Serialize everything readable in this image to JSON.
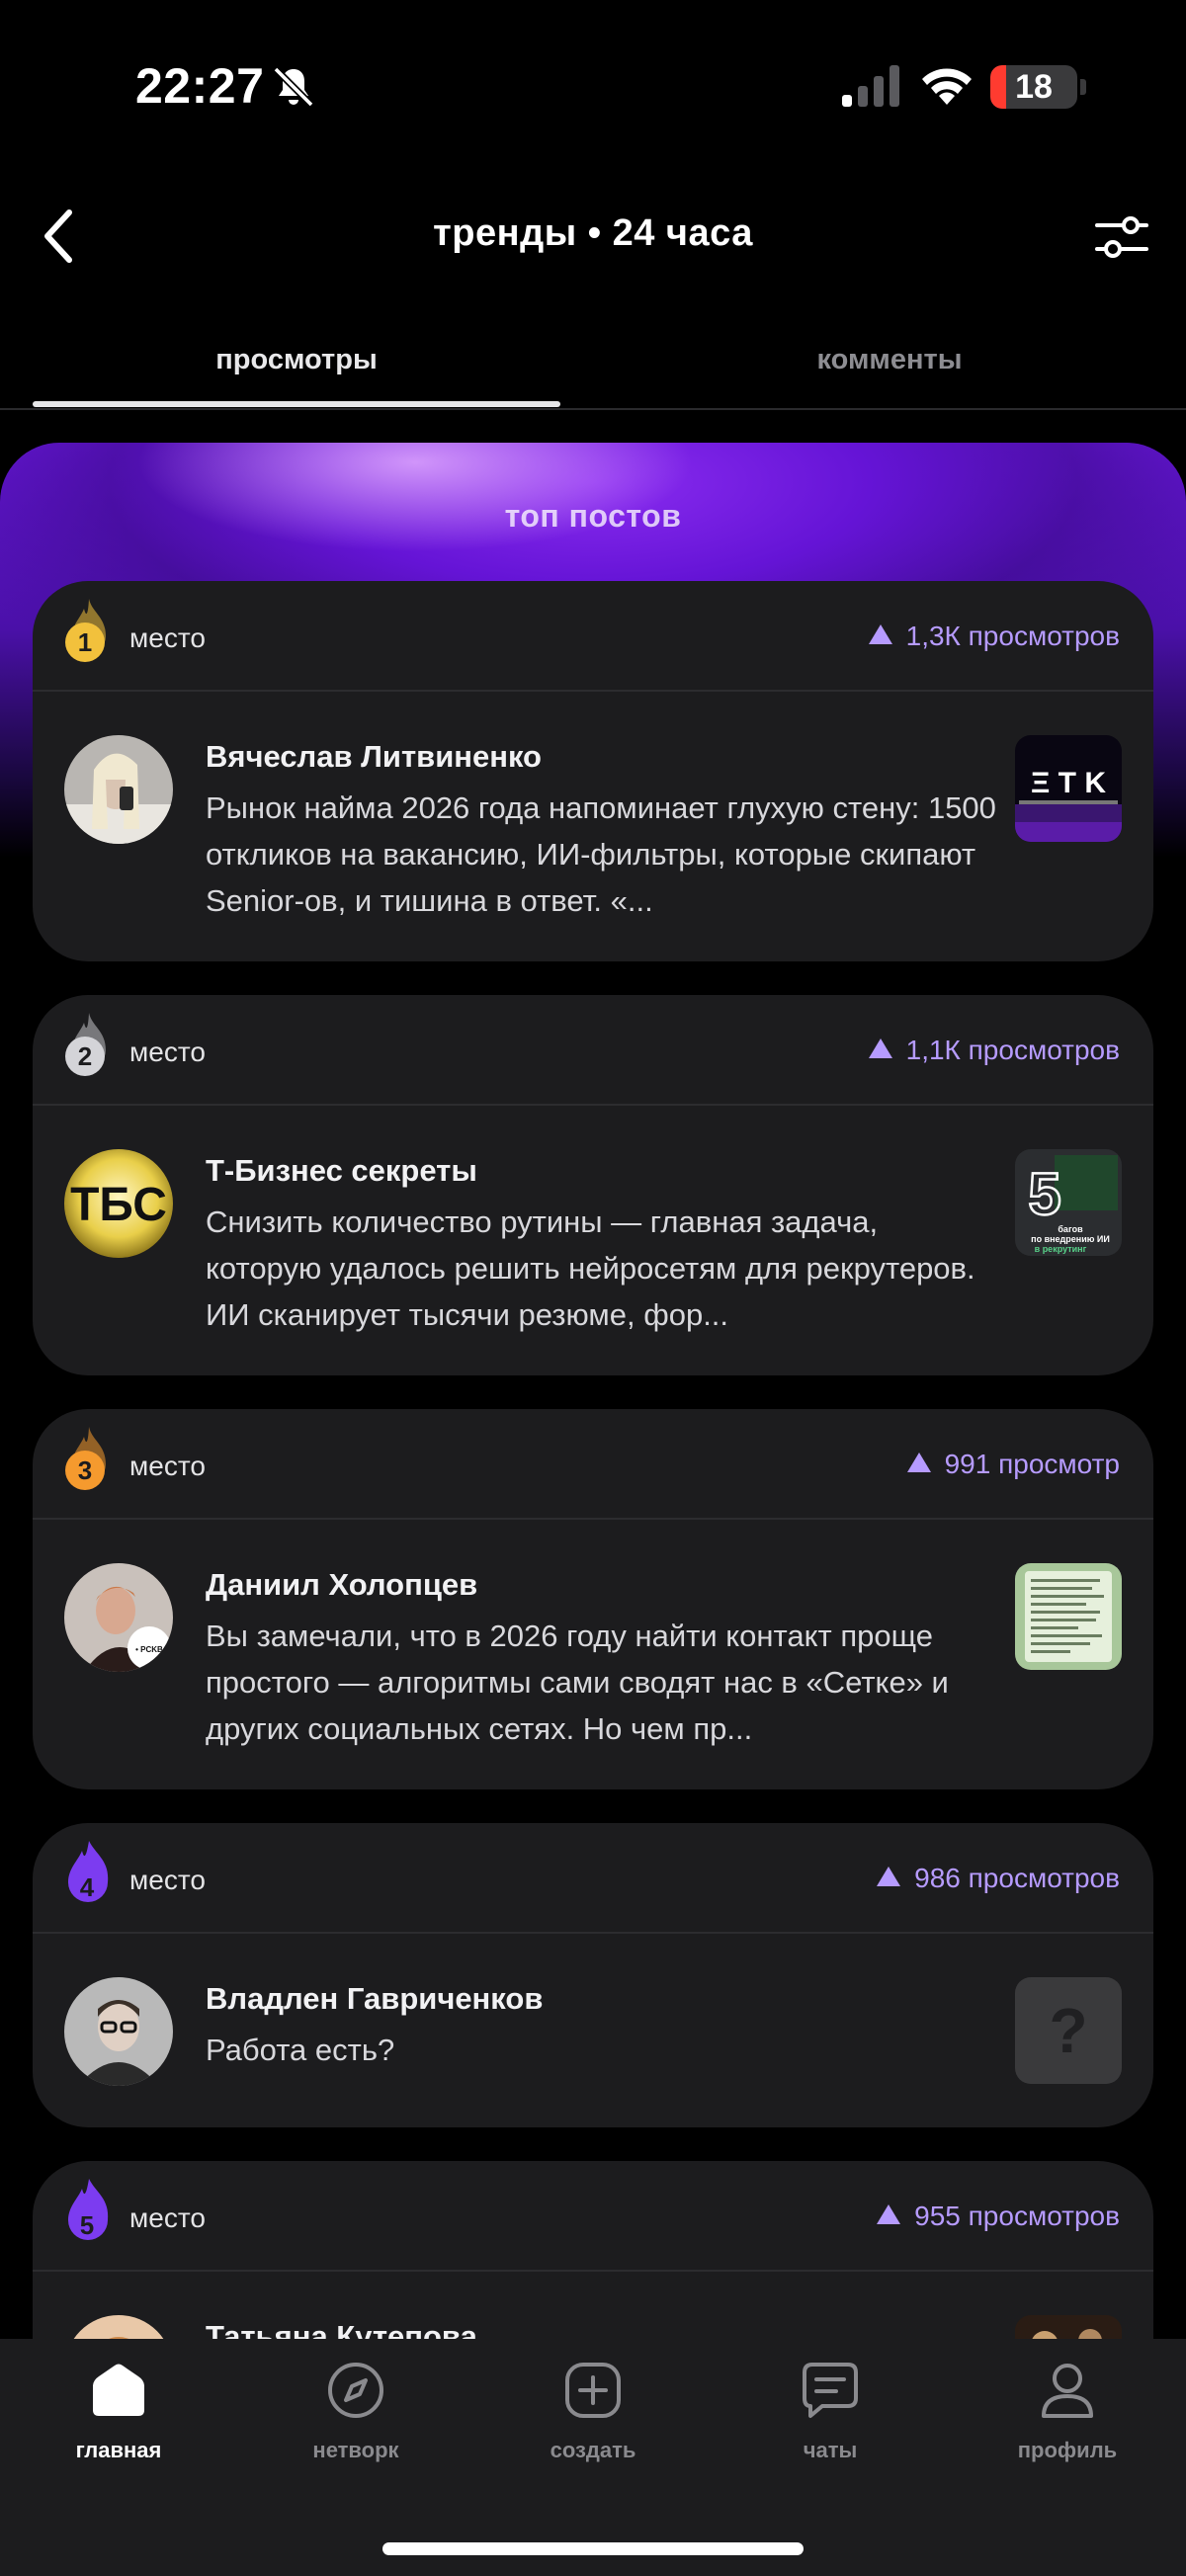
{
  "status_bar": {
    "time": "22:27",
    "battery": "18",
    "battery_level_percent": 18
  },
  "header": {
    "title": "тренды • 24 часа"
  },
  "tabs": [
    {
      "label": "просмотры",
      "active": true
    },
    {
      "label": "комменты",
      "active": false
    }
  ],
  "hero": {
    "title": "топ постов"
  },
  "posts": [
    {
      "rank": "1",
      "rank_suffix": "место",
      "rank_color": "#f2c13c",
      "views": "1,3К просмотров",
      "author": "Вячеслав Литвиненко",
      "text": "Рынок найма 2026 года напоминает глухую стену: 1500 откликов на вакансию, ИИ-фильтры, которые скипают Senior-ов, и тишина в ответ. «..."
    },
    {
      "rank": "2",
      "rank_suffix": "место",
      "rank_color": "#d4d4d8",
      "views": "1,1К просмотров",
      "author": "Т-Бизнес секреты",
      "avatar_text": "ТБС",
      "thumb_text": "5 багов по внедрению ИИ в рекрутинг",
      "thumb_number": "5",
      "text": "Снизить количество рутины — главная задача, которую удалось решить нейросетям для рекрутеров. ИИ сканирует тысячи резюме, фор..."
    },
    {
      "rank": "3",
      "rank_suffix": "место",
      "rank_color": "#f59a2e",
      "views": "991 просмотр",
      "author": "Даниил Холопцев",
      "text": "Вы замечали, что в 2026 году найти контакт проще простого — алгоритмы сами сводят нас в «Сетке» и других социальных сетях. Но чем пр..."
    },
    {
      "rank": "4",
      "rank_suffix": "место",
      "rank_color": "#7c3cf0",
      "views": "986 просмотров",
      "author": "Владлен Гавриченков",
      "thumb_text": "?",
      "text": "Работа есть?"
    },
    {
      "rank": "5",
      "rank_suffix": "место",
      "rank_color": "#7c3cf0",
      "views": "955 просмотров",
      "author": "Татьяна Кутепова",
      "text": ""
    }
  ],
  "nav": [
    {
      "label": "главная",
      "icon": "home-icon",
      "active": true
    },
    {
      "label": "нетворк",
      "icon": "compass-icon",
      "active": false
    },
    {
      "label": "создать",
      "icon": "plus-square-icon",
      "active": false
    },
    {
      "label": "чаты",
      "icon": "chat-icon",
      "active": false
    },
    {
      "label": "профиль",
      "icon": "person-icon",
      "active": false
    }
  ],
  "colors": {
    "accent": "#b69bff",
    "hero_purple": "#6514d6",
    "card_bg": "#1c1c1e",
    "battery_red": "#ff3b30"
  }
}
